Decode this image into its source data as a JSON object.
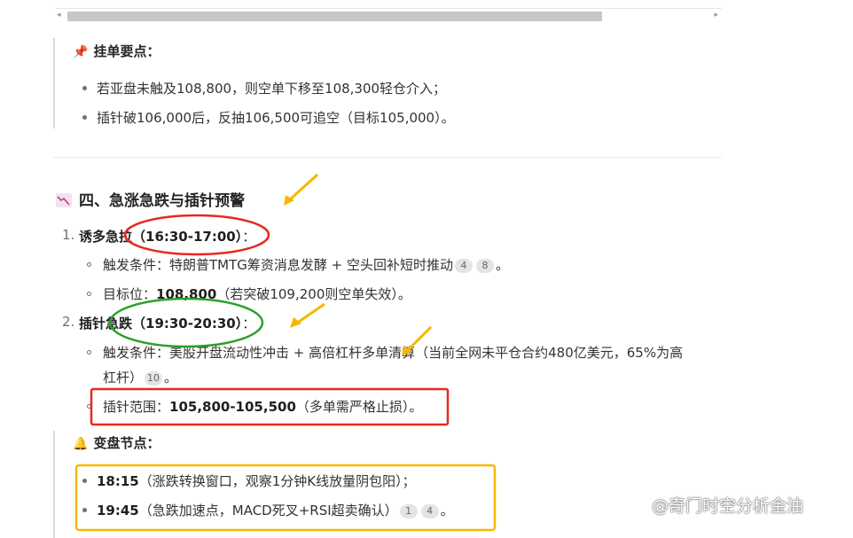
{
  "quote1": {
    "icon": "📌",
    "title": "挂单要点：",
    "items": [
      "若亚盘未触及108,800，则空单下移至108,300轻仓介入；",
      "插针破106,000后，反抽106,500可追空（目标105,000）。"
    ]
  },
  "section": {
    "title": "四、急涨急跌与插针预警",
    "items": [
      {
        "number": "1.",
        "label": "诱多急拉（16:30-17:00）",
        "suffix": "：",
        "sub": [
          {
            "text": "触发条件：特朗普TMTG筹资消息发酵 + 空头回补短时推动",
            "badges": [
              "4",
              "8"
            ],
            "tail": "。"
          },
          {
            "prefix": "目标位：",
            "bold": "108,800",
            "text": "（若突破109,200则空单失效）。"
          }
        ]
      },
      {
        "number": "2.",
        "label": "插针急跌（19:30-20:30）",
        "suffix": "：",
        "sub": [
          {
            "line1": "触发条件：美股开盘流动性冲击 + 高倍杠杆多单清算（当前全网未平仓合约480亿美元，65%为高",
            "line2": "杠杆）",
            "badges": [
              "10"
            ],
            "tail": "。"
          },
          {
            "prefix": "插针范围：",
            "bold": "105,800-105,500",
            "text": "（多单需严格止损）。"
          }
        ]
      }
    ]
  },
  "quote2": {
    "icon": "🔔",
    "title": "变盘节点：",
    "items": [
      {
        "bold": "18:15",
        "text": "（涨跌转换窗口，观察1分钟K线放量阴包阳）；"
      },
      {
        "bold": "19:45",
        "text": "（急跌加速点，MACD死叉+RSI超卖确认）",
        "badges": [
          "1",
          "4"
        ],
        "tail": "。"
      }
    ]
  },
  "watermark": "@奇门时空分析金油",
  "colors": {
    "red": "#e8281e",
    "green": "#2aa12a",
    "yellow": "#f5b800",
    "arrow": "#f5b800"
  }
}
